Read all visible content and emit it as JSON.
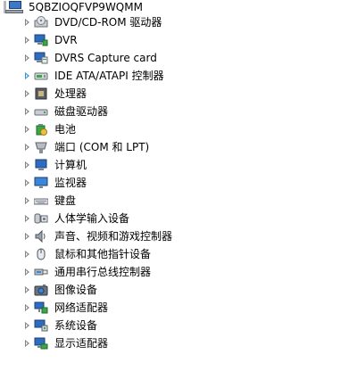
{
  "root": {
    "label": "5QBZIOQFVP9WQMM",
    "icon": "computer-icon"
  },
  "items": [
    {
      "label": "DVD/CD-ROM 驱动器",
      "icon": "dvd-drive-icon"
    },
    {
      "label": "DVR",
      "icon": "monitor-network-icon"
    },
    {
      "label": "DVRS Capture card",
      "icon": "capture-card-icon"
    },
    {
      "label": "IDE ATA/ATAPI 控制器",
      "icon": "ide-controller-icon"
    },
    {
      "label": "处理器",
      "icon": "processor-icon"
    },
    {
      "label": "磁盘驱动器",
      "icon": "disk-drive-icon"
    },
    {
      "label": "电池",
      "icon": "battery-icon"
    },
    {
      "label": "端口 (COM 和 LPT)",
      "icon": "port-icon"
    },
    {
      "label": "计算机",
      "icon": "computer-icon"
    },
    {
      "label": "监视器",
      "icon": "monitor-icon"
    },
    {
      "label": "键盘",
      "icon": "keyboard-icon"
    },
    {
      "label": "人体学输入设备",
      "icon": "hid-icon"
    },
    {
      "label": "声音、视频和游戏控制器",
      "icon": "speaker-icon"
    },
    {
      "label": "鼠标和其他指针设备",
      "icon": "mouse-icon"
    },
    {
      "label": "通用串行总线控制器",
      "icon": "usb-icon"
    },
    {
      "label": "图像设备",
      "icon": "camera-icon"
    },
    {
      "label": "网络适配器",
      "icon": "network-adapter-icon"
    },
    {
      "label": "系统设备",
      "icon": "system-device-icon"
    },
    {
      "label": "显示适配器",
      "icon": "display-adapter-icon"
    }
  ]
}
